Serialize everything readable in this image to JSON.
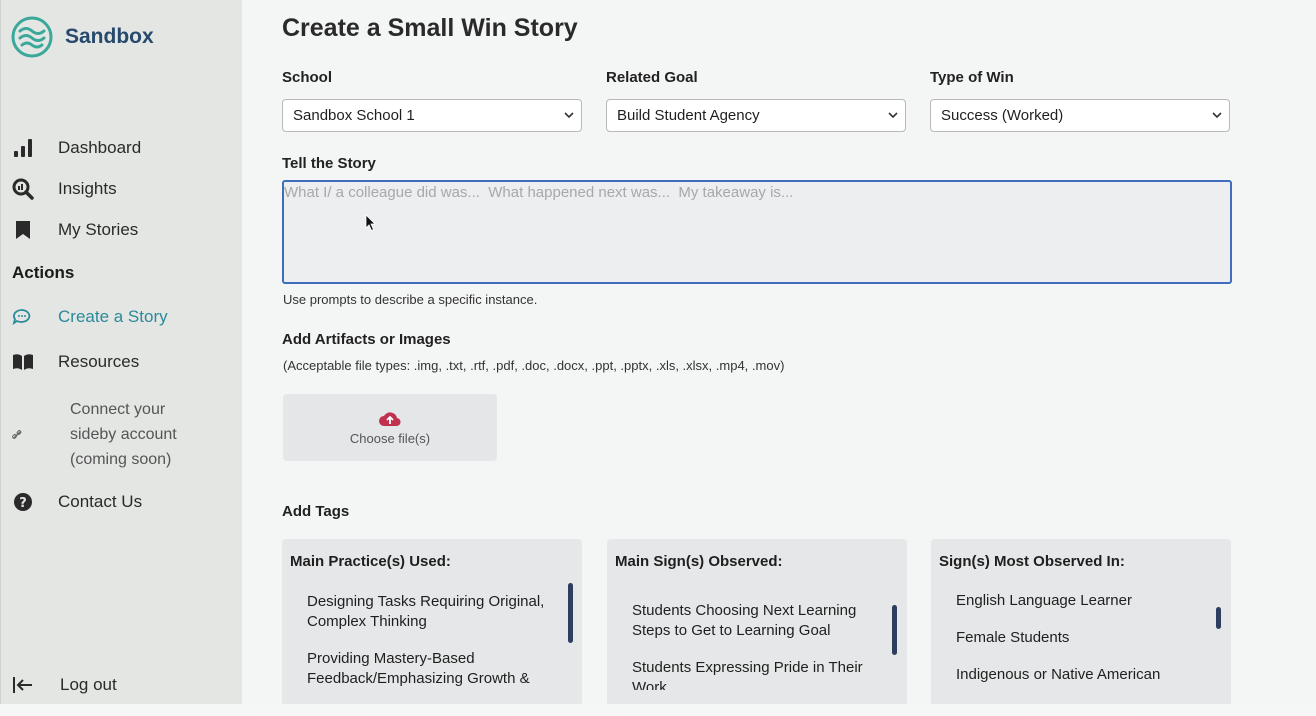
{
  "brand": {
    "name": "Sandbox"
  },
  "nav": {
    "dashboard": "Dashboard",
    "insights": "Insights",
    "my_stories": "My Stories",
    "actions_heading": "Actions",
    "create_story": "Create a Story",
    "resources": "Resources",
    "connect": "Connect your sideby account (coming soon)",
    "contact": "Contact Us",
    "logout": "Log out"
  },
  "form": {
    "title": "Create a Small Win Story",
    "school_label": "School",
    "school_value": "Sandbox School 1",
    "goal_label": "Related Goal",
    "goal_value": "Build Student Agency",
    "win_label": "Type of Win",
    "win_value": "Success (Worked)",
    "story_label": "Tell the Story",
    "story_placeholder": "What I/ a colleague did was...  What happened next was...  My takeaway is...",
    "story_hint": "Use prompts to describe a specific instance.",
    "artifacts_label": "Add Artifacts or Images",
    "artifacts_types": "(Acceptable file types: .img, .txt, .rtf, .pdf, .doc, .docx, .ppt, .pptx, .xls, .xlsx, .mp4, .mov)",
    "upload_label": "Choose file(s)",
    "tags_label": "Add Tags"
  },
  "tags": {
    "practices": {
      "title": "Main Practice(s) Used:",
      "items": [
        "Designing Tasks Requiring Original, Complex Thinking",
        "Providing Mastery-Based Feedback/Emphasizing Growth &"
      ]
    },
    "signs": {
      "title": "Main Sign(s) Observed:",
      "items": [
        "Students Choosing Next Learning Steps to Get to Learning Goal",
        "Students Expressing Pride in Their Work"
      ]
    },
    "observed_in": {
      "title": "Sign(s) Most Observed In:",
      "items": [
        "English Language Learner",
        "Female Students",
        "Indigenous or Native American"
      ]
    }
  },
  "colors": {
    "brand": "#27496d",
    "active": "#2b8a9b",
    "focus": "#3e6ebd",
    "upload_icon": "#c2304f"
  }
}
